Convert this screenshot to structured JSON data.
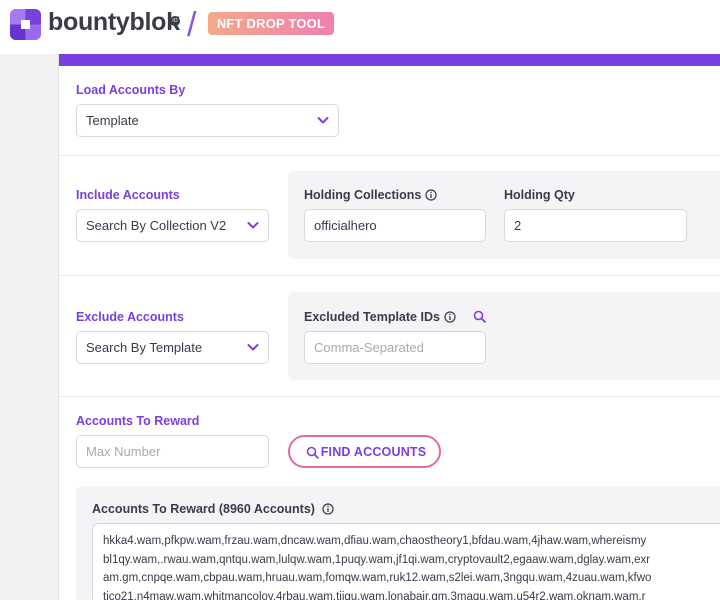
{
  "header": {
    "brand": "bountyblok",
    "brand_tag": "IO",
    "divider": "/",
    "badge": "NFT DROP TOOL"
  },
  "load_accounts": {
    "label": "Load Accounts By",
    "selected": "Template"
  },
  "include_accounts": {
    "label": "Include Accounts",
    "selected": "Search By Collection V2",
    "holding_collections_label": "Holding Collections",
    "holding_collections_value": "officialhero",
    "holding_qty_label": "Holding Qty",
    "holding_qty_value": "2"
  },
  "exclude_accounts": {
    "label": "Exclude Accounts",
    "selected": "Search By Template",
    "excluded_template_ids_label": "Excluded Template IDs",
    "excluded_template_ids_placeholder": "Comma-Separated"
  },
  "accounts_to_reward": {
    "label": "Accounts To Reward",
    "max_placeholder": "Max Number",
    "find_button": "FIND ACCOUNTS"
  },
  "results": {
    "label": "Accounts To Reward (8960 Accounts)",
    "lines": [
      "hkka4.wam,pfkpw.wam,frzau.wam,dncaw.wam,dfiau.wam,chaostheory1,bfdau.wam,4jhaw.wam,whereismy",
      "bl1qy.wam,.rwau.wam,qntqu.wam,lulqw.wam,1puqy.wam,jf1qi.wam,cryptovault2,egaaw.wam,dglay.wam,exr",
      "am.gm,cnpqe.wam,cbpau.wam,hruau.wam,fomqw.wam,ruk12.wam,s2lei.wam,3ngqu.wam,4zuau.wam,kfwo",
      "tico21.n4maw.wam.whitmancolov.4rbau.wam.tiiqu.wam.lonabair.gm.3maqu.wam.u54r2.wam.oknam.wam.r"
    ]
  },
  "colors": {
    "accent": "#7a3fe0",
    "pink": "#e46aa2"
  }
}
